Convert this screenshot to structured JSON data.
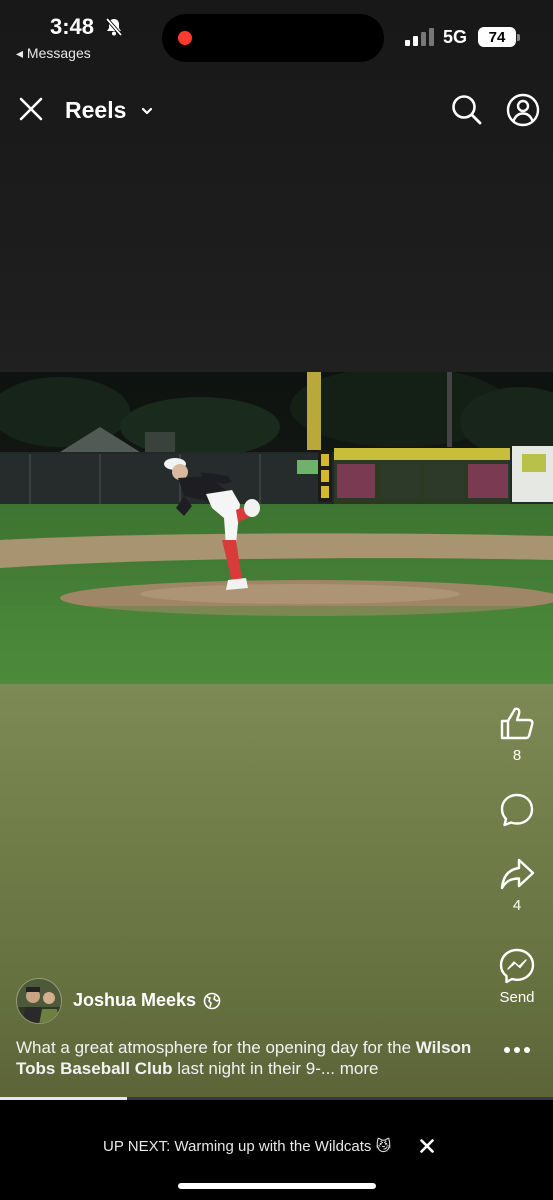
{
  "status_bar": {
    "time": "3:48",
    "back_app": "◂ Messages",
    "network": "5G",
    "battery": "74"
  },
  "header": {
    "title": "Reels"
  },
  "actions": {
    "like_count": "8",
    "share_count": "4",
    "send_label": "Send"
  },
  "post": {
    "author": "Joshua Meeks",
    "caption_start": "What a great atmosphere for the opening day for the ",
    "caption_bold": "Wilson Tobs Baseball Club",
    "caption_end": " last night in their 9-... ",
    "more_label": "more",
    "progress": 0.23
  },
  "up_next": {
    "prefix": "UP NEXT:",
    "title": " Warming up with the Wildcats 😼"
  },
  "icons": {
    "close": "close-icon",
    "chevron": "chevron-down-icon",
    "search": "search-icon",
    "profile": "profile-icon",
    "like": "thumbs-up-icon",
    "comment": "comment-icon",
    "share": "share-icon",
    "send": "messenger-icon",
    "more": "more-dots-icon",
    "privacy": "globe-icon",
    "mute": "bell-slash-icon"
  },
  "colors": {
    "background": "#000000",
    "recording_dot": "#ff3b30",
    "grass": "#3f7a2e",
    "overlay_olive": "#6f7c48"
  }
}
